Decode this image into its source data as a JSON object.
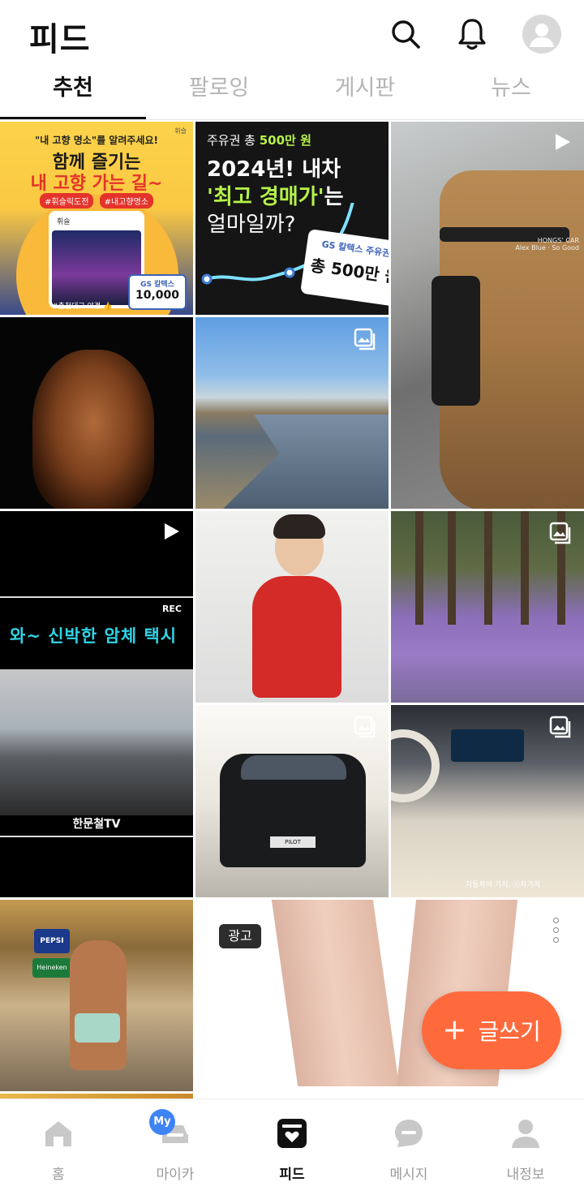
{
  "header": {
    "title": "피드"
  },
  "tabs": [
    {
      "label": "추천",
      "active": true
    },
    {
      "label": "팔로잉",
      "active": false
    },
    {
      "label": "게시판",
      "active": false
    },
    {
      "label": "뉴스",
      "active": false
    }
  ],
  "feed": {
    "tile1": {
      "top_text": "\"내 고향 명소\"를 알려주세요!",
      "headline1": "함께 즐기는",
      "headline2": "내 고향 가는 길~",
      "tag1": "#휘슬릭도전",
      "tag2": "#내고향명소",
      "card_title": "휘슬",
      "corner": "휘슬",
      "sticker_brand": "GS 칼텍스",
      "sticker_amount": "10,000",
      "footer": "#춘천대교 야경 👍"
    },
    "tile2": {
      "line1_prefix": "주유권 총 ",
      "line1_highlight": "500만 원",
      "line2": "2024년! 내차",
      "line3_highlight": "'최고 경매가'",
      "line3_suffix": "는",
      "line4": "얼마일까?",
      "card_brand": "GS 칼텍스 주유권",
      "card_amount": "총 500만 원"
    },
    "tile3": {
      "watermark1": "HONGS’ CAR",
      "watermark2": "Alex Blue · So Good"
    },
    "tile6": {
      "rec": "REC",
      "caption": "와~ 신박한 암체 택시",
      "channel": "한문철TV"
    },
    "tile9": {
      "plate": "PILOT"
    },
    "tile10": {
      "watermark": "자동차의 가치, ⓒ차가치"
    },
    "tile11": {
      "brand1": "PEPSI",
      "brand2": "Heineken"
    },
    "ad": {
      "badge": "광고"
    }
  },
  "fab": {
    "plus": "+",
    "label": "글쓰기",
    "color": "#ff6a3d"
  },
  "bottom_nav": [
    {
      "label": "홈",
      "icon": "home-icon",
      "active": false
    },
    {
      "label": "마이카",
      "icon": "car-icon",
      "active": false,
      "badge": "My"
    },
    {
      "label": "피드",
      "icon": "feed-icon",
      "active": true
    },
    {
      "label": "메시지",
      "icon": "message-icon",
      "active": false
    },
    {
      "label": "내정보",
      "icon": "profile-icon",
      "active": false
    }
  ]
}
